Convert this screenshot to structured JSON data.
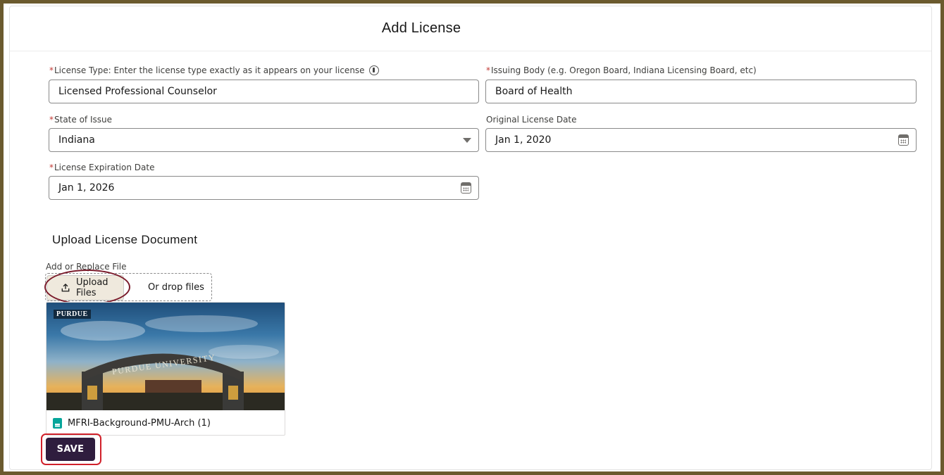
{
  "header": {
    "title": "Add License"
  },
  "form": {
    "license_type": {
      "label": "License Type: Enter the license type exactly as it appears on your license",
      "required_mark": "*",
      "value": "Licensed Professional Counselor"
    },
    "issuing_body": {
      "label": "Issuing Body (e.g. Oregon Board, Indiana Licensing Board, etc)",
      "required_mark": "*",
      "value": "Board of Health"
    },
    "state_of_issue": {
      "label": "State of Issue",
      "required_mark": "*",
      "value": "Indiana"
    },
    "original_license_date": {
      "label": "Original License Date",
      "value": "Jan 1, 2020"
    },
    "license_expiration_date": {
      "label": "License Expiration Date",
      "required_mark": "*",
      "value": "Jan 1, 2026"
    }
  },
  "upload": {
    "section_title": "Upload License Document",
    "field_label": "Add or Replace File",
    "button_label": "Upload Files",
    "drop_text": "Or drop files",
    "file": {
      "thumbnail_logo_text": "PURDUE",
      "thumbnail_arch_text": "PURDUE UNIVERSITY",
      "name": "MFRI-Background-PMU-Arch (1)"
    }
  },
  "actions": {
    "save_label": "SAVE"
  },
  "colors": {
    "frame_border": "#6b5a2e",
    "save_button": "#2f1d3e",
    "required": "#c23934",
    "upload_highlight": "#7a1a2a",
    "save_highlight": "#d0202a",
    "file_icon": "#06a59a"
  },
  "icons": {
    "info": "info-icon",
    "dropdown": "chevron-down-icon",
    "calendar": "calendar-icon",
    "upload": "upload-icon",
    "file": "document-icon"
  }
}
